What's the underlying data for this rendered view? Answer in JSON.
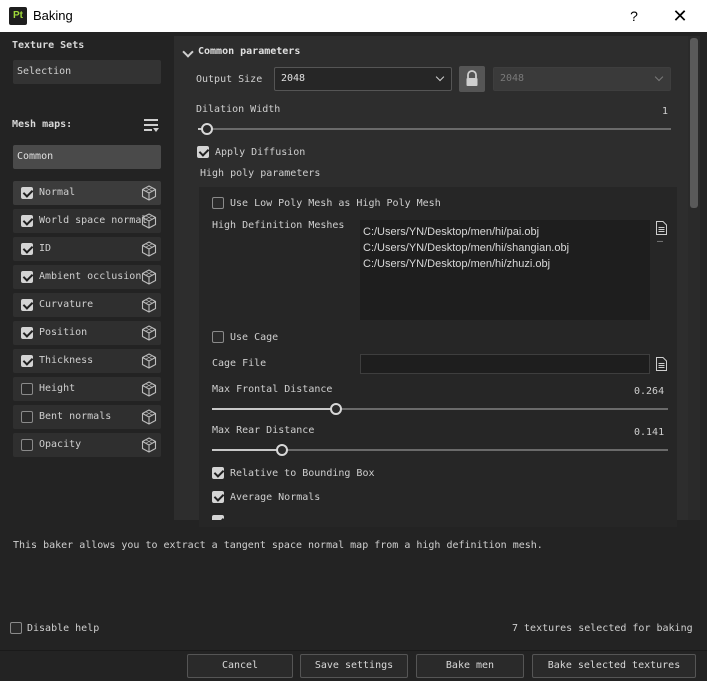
{
  "window": {
    "app_icon_text": "Pt",
    "title": "Baking",
    "help": "?",
    "close": "✕"
  },
  "left": {
    "texture_sets_heading": "Texture Sets",
    "texture_set_selection": "Selection",
    "mesh_maps_heading": "Mesh maps:",
    "common_label": "Common",
    "mesh_maps": [
      {
        "label": "Normal",
        "checked": true
      },
      {
        "label": "World space normal",
        "checked": true
      },
      {
        "label": "ID",
        "checked": true
      },
      {
        "label": "Ambient occlusion",
        "checked": true
      },
      {
        "label": "Curvature",
        "checked": true
      },
      {
        "label": "Position",
        "checked": true
      },
      {
        "label": "Thickness",
        "checked": true
      },
      {
        "label": "Height",
        "checked": false
      },
      {
        "label": "Bent normals",
        "checked": false
      },
      {
        "label": "Opacity",
        "checked": false
      }
    ]
  },
  "params": {
    "section_title": "Common parameters",
    "output_size_label": "Output Size",
    "output_size_value": "2048",
    "output_size_locked_value": "2048",
    "dilation_width_label": "Dilation Width",
    "dilation_width_value": "1",
    "dilation_width_fraction": 0.02,
    "apply_diffusion_label": "Apply Diffusion",
    "apply_diffusion_checked": true,
    "high_poly_heading": "High poly parameters",
    "use_low_poly_label": "Use Low Poly Mesh as High Poly Mesh",
    "use_low_poly_checked": false,
    "hd_meshes_label": "High Definition Meshes",
    "hd_meshes": [
      "C:/Users/YN/Desktop/men/hi/pai.obj",
      "C:/Users/YN/Desktop/men/hi/shangian.obj",
      "C:/Users/YN/Desktop/men/hi/zhuzi.obj"
    ],
    "hd_meshes_remove": "–",
    "use_cage_label": "Use Cage",
    "use_cage_checked": false,
    "cage_file_label": "Cage File",
    "cage_file_value": "",
    "max_frontal_label": "Max Frontal Distance",
    "max_frontal_value": "0.264",
    "max_frontal_fraction": 0.264,
    "max_rear_label": "Max Rear Distance",
    "max_rear_value": "0.141",
    "max_rear_fraction": 0.141,
    "relative_bbox_label": "Relative to Bounding Box",
    "relative_bbox_checked": true,
    "average_normals_label": "Average Normals",
    "average_normals_checked": true,
    "partial_row_checked": true
  },
  "help": {
    "description": "This baker allows you to extract a tangent space normal map from a high definition mesh.",
    "disable_help_label": "Disable help",
    "disable_help_checked": false,
    "selected_count_text": "7 textures selected for baking"
  },
  "buttons": {
    "cancel": "Cancel",
    "save_settings": "Save settings",
    "bake_men": "Bake men",
    "bake_selected": "Bake selected textures"
  },
  "icons": {
    "filter": "filter-list-icon",
    "cube": "cube-icon",
    "lock": "lock-icon",
    "file": "file-icon"
  },
  "colors": {
    "checkbox_on": "#d4d4d4",
    "panel": "#2d2d2d",
    "background": "#232323",
    "app_icon_accent": "#9fd93a"
  }
}
